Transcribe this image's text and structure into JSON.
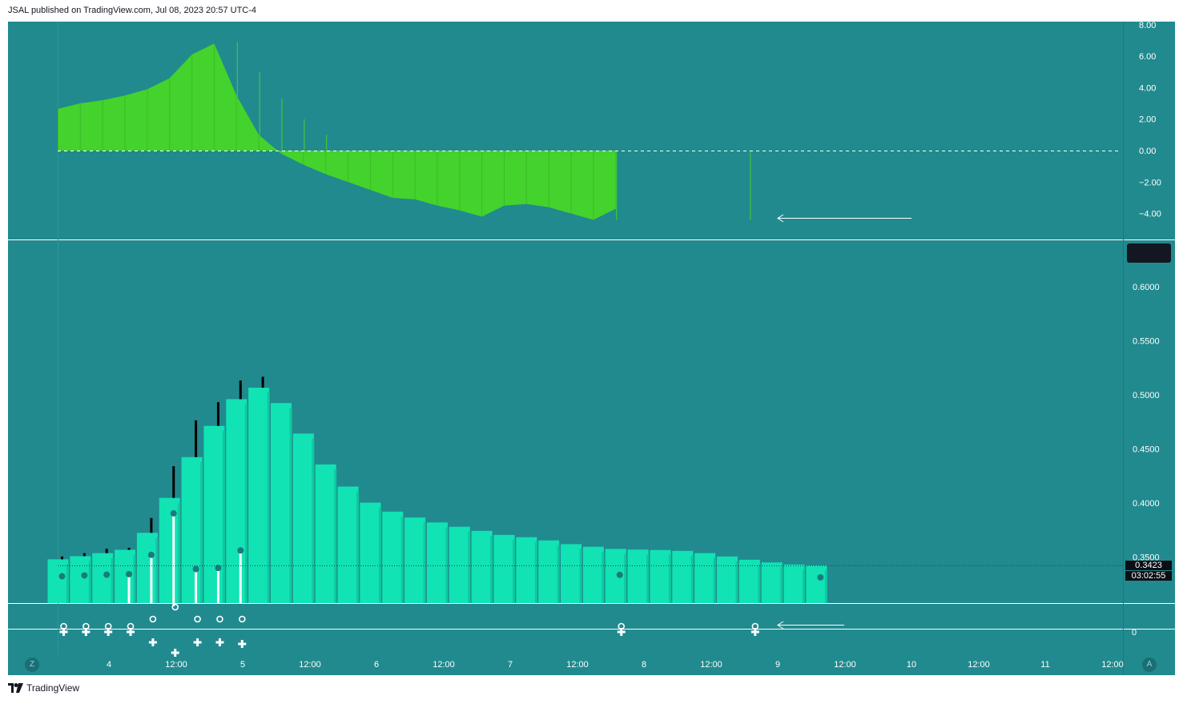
{
  "header": {
    "published": "JSAL published on TradingView.com, Jul 08, 2023 20:57 UTC-4"
  },
  "footer": {
    "brand": "TradingView",
    "logo_icon": "tradingview-logo-icon"
  },
  "colors": {
    "background": "#218a8e",
    "oscillator_fill": "#44d22c",
    "price_bars": "#11e3b5",
    "stem_up": "#000000",
    "stem_down": "#ffffff",
    "marker_dot": "#1a7a7c"
  },
  "buttons": {
    "left": "Z",
    "right": "A"
  },
  "price_tag": {
    "price": "0.3423",
    "countdown": "03:02:55"
  },
  "chart_data": [
    {
      "type": "area",
      "pane": "oscillator",
      "y_ticks": [
        "8.00",
        "6.00",
        "4.00",
        "2.00",
        "0.00",
        "−2.00",
        "−4.00"
      ],
      "ylim": [
        -5.5,
        8.0
      ],
      "zero_line": "dashed",
      "annotation": "arrow pointing left at last value",
      "values": [
        2.65,
        3.0,
        3.2,
        3.5,
        3.9,
        4.6,
        6.1,
        6.8,
        3.5,
        1.0,
        -0.2,
        -0.9,
        -1.5,
        -2.0,
        -2.5,
        -3.0,
        -3.1,
        -3.5,
        -3.8,
        -4.2,
        -3.5,
        -3.4,
        -3.6,
        -4.0,
        -4.4,
        -3.7
      ],
      "spikes": [
        {
          "index": 8,
          "value": 6.9
        },
        {
          "index": 9,
          "value": 5.0
        },
        {
          "index": 10,
          "value": 3.3
        },
        {
          "index": 11,
          "value": 2.0
        },
        {
          "index": 12,
          "value": 1.0
        },
        {
          "index": 25,
          "value": -4.4
        },
        {
          "index": 31,
          "value": -4.4
        }
      ]
    },
    {
      "type": "bar",
      "pane": "price",
      "y_ticks": [
        "0.6000",
        "0.5500",
        "0.5000",
        "0.4500",
        "0.4000",
        "0.3500"
      ],
      "ylim": [
        0.305,
        0.655
      ],
      "last_price_line": 0.3423,
      "values": [
        0.3479,
        0.3508,
        0.3536,
        0.3567,
        0.3724,
        0.4047,
        0.4424,
        0.4713,
        0.496,
        0.5066,
        0.4924,
        0.4642,
        0.4356,
        0.4152,
        0.4003,
        0.392,
        0.3865,
        0.382,
        0.378,
        0.3742,
        0.3705,
        0.3683,
        0.3654,
        0.3619,
        0.3595,
        0.3575,
        0.3569,
        0.3565,
        0.3557,
        0.3536,
        0.3505,
        0.3475,
        0.345,
        0.3431,
        0.3423
      ],
      "highs": [
        0.3505,
        0.3536,
        0.3576,
        0.3585,
        0.3861,
        0.434,
        0.4764,
        0.4932,
        0.5132,
        0.5167,
        null,
        null,
        null,
        null,
        null,
        null,
        null,
        null,
        null,
        null,
        null,
        null,
        null,
        null,
        null,
        null,
        null,
        null,
        null,
        null,
        null,
        null,
        null,
        null,
        null
      ],
      "dots": [
        0.3322,
        0.333,
        0.3337,
        0.3342,
        0.352,
        0.3904,
        0.3389,
        0.3399,
        0.3561,
        null,
        null,
        null,
        null,
        null,
        null,
        null,
        null,
        null,
        null,
        null,
        null,
        null,
        null,
        null,
        null,
        0.3335,
        null,
        null,
        null,
        null,
        null,
        null,
        null,
        null,
        0.3312
      ],
      "white_stems": [
        false,
        false,
        false,
        true,
        true,
        true,
        true,
        true,
        true,
        false,
        false,
        false,
        false,
        false,
        false,
        false,
        false,
        false,
        false,
        false,
        false,
        false,
        false,
        false,
        false,
        false,
        false,
        false,
        false,
        false,
        false,
        false,
        false,
        false,
        false
      ]
    },
    {
      "type": "scatter",
      "pane": "signals",
      "y_ticks": [
        "0"
      ],
      "annotation": "arrow pointing left at last signal",
      "signals": [
        {
          "index": 0,
          "circle": "upper",
          "cross": "upper"
        },
        {
          "index": 1,
          "circle": "upper",
          "cross": "upper"
        },
        {
          "index": 2,
          "circle": "upper",
          "cross": "upper"
        },
        {
          "index": 3,
          "circle": "upper",
          "cross": "upper"
        },
        {
          "index": 4,
          "circle": "lower",
          "cross": "lower"
        },
        {
          "index": 5,
          "circle": "mid",
          "cross": "bottom"
        },
        {
          "index": 6,
          "circle": "lower",
          "cross": "lower"
        },
        {
          "index": 7,
          "circle": "lower",
          "cross": "lower"
        },
        {
          "index": 8,
          "circle": "low",
          "cross": "lowest"
        },
        {
          "index": 25,
          "circle": "upper",
          "cross": "upper"
        },
        {
          "index": 31,
          "circle": "upper",
          "cross": "upper"
        }
      ]
    }
  ],
  "time_axis": [
    "4",
    "12:00",
    "5",
    "12:00",
    "6",
    "12:00",
    "7",
    "12:00",
    "8",
    "12:00",
    "9",
    "12:00",
    "10",
    "12:00",
    "11",
    "12:00"
  ]
}
